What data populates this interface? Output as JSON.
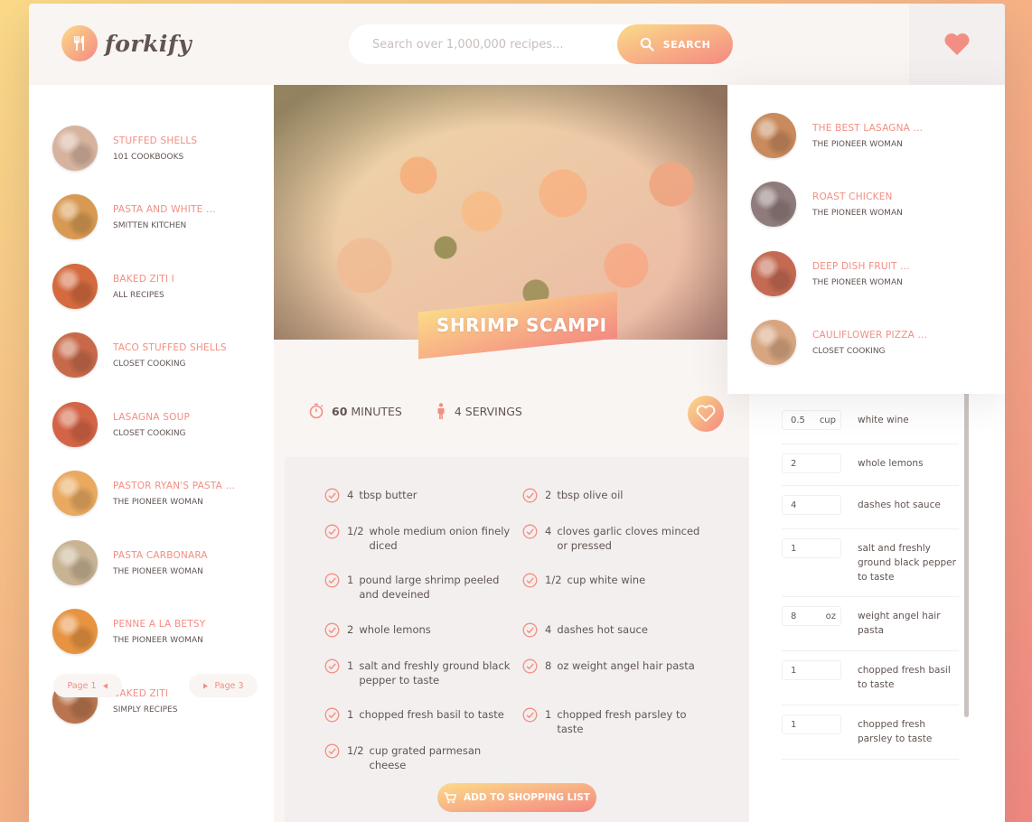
{
  "app": {
    "name": "forkify"
  },
  "search": {
    "placeholder": "Search over 1,000,000 recipes...",
    "button_label": "SEARCH"
  },
  "results": [
    {
      "title": "STUFFED SHELLS",
      "author": "101 COOKBOOKS",
      "color": "#d7b39f"
    },
    {
      "title": "PASTA AND WHITE ...",
      "author": "SMITTEN KITCHEN",
      "color": "#d89a52"
    },
    {
      "title": "BAKED ZITI I",
      "author": "ALL RECIPES",
      "color": "#d46a3e"
    },
    {
      "title": "TACO STUFFED SHELLS",
      "author": "CLOSET COOKING",
      "color": "#c86a4a"
    },
    {
      "title": "LASAGNA SOUP",
      "author": "CLOSET COOKING",
      "color": "#d36446"
    },
    {
      "title": "PASTOR RYAN'S PASTA ...",
      "author": "THE PIONEER WOMAN",
      "color": "#e9a960"
    },
    {
      "title": "PASTA CARBONARA",
      "author": "THE PIONEER WOMAN",
      "color": "#c8b393"
    },
    {
      "title": "PENNE A LA BETSY",
      "author": "THE PIONEER WOMAN",
      "color": "#e89341"
    },
    {
      "title": "BAKED ZITI",
      "author": "SIMPLY RECIPES",
      "color": "#b9754f"
    }
  ],
  "pagination": {
    "prev": "Page 1",
    "next": "Page 3"
  },
  "recipe": {
    "title": "SHRIMP SCAMPI",
    "time_value": "60",
    "time_unit": "MINUTES",
    "servings_value": "4",
    "servings_unit": "SERVINGS",
    "ingredients": [
      {
        "count": "4",
        "text": "tbsp butter"
      },
      {
        "count": "2",
        "text": "tbsp olive oil"
      },
      {
        "count": "1/2",
        "text": "whole medium onion finely diced"
      },
      {
        "count": "4",
        "text": "cloves garlic cloves minced or pressed"
      },
      {
        "count": "1",
        "text": "pound large shrimp peeled and deveined"
      },
      {
        "count": "1/2",
        "text": "cup white wine"
      },
      {
        "count": "2",
        "text": "whole lemons"
      },
      {
        "count": "4",
        "text": "dashes hot sauce"
      },
      {
        "count": "1",
        "text": "salt and freshly ground black pepper to taste"
      },
      {
        "count": "8",
        "text": "oz weight angel hair pasta"
      },
      {
        "count": "1",
        "text": "chopped fresh basil to taste"
      },
      {
        "count": "1",
        "text": "chopped fresh parsley to taste"
      },
      {
        "count": "1/2",
        "text": "cup grated parmesan cheese"
      }
    ],
    "shopping_button": "ADD TO SHOPPING LIST"
  },
  "shopping_list": [
    {
      "count": "0.5",
      "unit": "cup",
      "desc": "white wine"
    },
    {
      "count": "2",
      "unit": "",
      "desc": "whole lemons"
    },
    {
      "count": "4",
      "unit": "",
      "desc": "dashes hot sauce"
    },
    {
      "count": "1",
      "unit": "",
      "desc": "salt and freshly ground black pepper to taste"
    },
    {
      "count": "8",
      "unit": "oz",
      "desc": "weight angel hair pasta"
    },
    {
      "count": "1",
      "unit": "",
      "desc": "chopped fresh basil to taste"
    },
    {
      "count": "1",
      "unit": "",
      "desc": "chopped fresh parsley to taste"
    }
  ],
  "likes": [
    {
      "title": "THE BEST LASAGNA ...",
      "author": "THE PIONEER WOMAN",
      "color": "#c98a5d"
    },
    {
      "title": "ROAST CHICKEN",
      "author": "THE PIONEER WOMAN",
      "color": "#8f7b7b"
    },
    {
      "title": "DEEP DISH FRUIT ...",
      "author": "THE PIONEER WOMAN",
      "color": "#c46a52"
    },
    {
      "title": "CAULIFLOWER PIZZA ...",
      "author": "CLOSET COOKING",
      "color": "#d7a680"
    }
  ],
  "colors": {
    "accent": "#f38e82",
    "gradient_start": "#fbdb89",
    "gradient_end": "#f48982",
    "text": "#615551"
  }
}
